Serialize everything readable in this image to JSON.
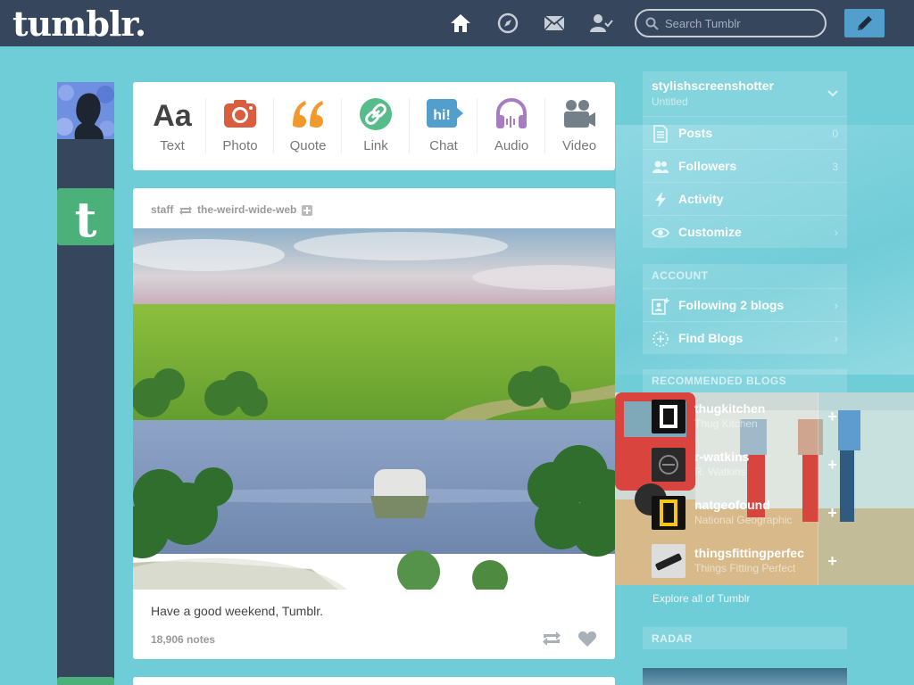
{
  "header": {
    "logo": "tumblr.",
    "search_placeholder": "Search Tumblr",
    "nav": [
      "home-icon",
      "explore-icon",
      "inbox-icon",
      "account-icon"
    ]
  },
  "composer": {
    "types": [
      {
        "label": "Text",
        "icon": "text-icon",
        "color": "#444444"
      },
      {
        "label": "Photo",
        "icon": "camera-icon",
        "color": "#d95e40"
      },
      {
        "label": "Quote",
        "icon": "quote-icon",
        "color": "#f2992e"
      },
      {
        "label": "Link",
        "icon": "link-icon",
        "color": "#56bc8a"
      },
      {
        "label": "Chat",
        "icon": "chat-icon",
        "color": "#529ecc"
      },
      {
        "label": "Audio",
        "icon": "headphones-icon",
        "color": "#a77dc2"
      },
      {
        "label": "Video",
        "icon": "video-camera-icon",
        "color": "#748089"
      }
    ]
  },
  "post": {
    "author": "staff",
    "reblogged_from": "the-weird-wide-web",
    "caption": "Have a good weekend, Tumblr.",
    "notes": "18,906 notes"
  },
  "sidebar": {
    "blog_name": "stylishscreenshotter",
    "blog_title": "Untitled",
    "blog_items": [
      {
        "label": "Posts",
        "count": "0",
        "icon": "posts-icon"
      },
      {
        "label": "Followers",
        "count": "3",
        "icon": "followers-icon"
      },
      {
        "label": "Activity",
        "count": "",
        "icon": "activity-icon"
      },
      {
        "label": "Customize",
        "count": "",
        "icon": "eye-icon"
      }
    ],
    "account_title": "ACCOUNT",
    "account_items": [
      {
        "label": "Following 2 blogs",
        "icon": "following-icon"
      },
      {
        "label": "Find Blogs",
        "icon": "find-blogs-icon"
      }
    ],
    "recommended_title": "RECOMMENDED BLOGS",
    "recommended": [
      {
        "name": "thugkitchen",
        "sub": "Thug Kitchen"
      },
      {
        "name": "r-watkins",
        "sub": "R. Watkins"
      },
      {
        "name": "natgeofound",
        "sub": "National Geographic"
      },
      {
        "name": "thingsfittingperfec",
        "sub": "Things Fitting Perfect"
      }
    ],
    "explore": "Explore all of Tumblr",
    "radar_title": "RADAR"
  },
  "colors": {
    "background": "#6fcdd8",
    "header": "#36465d",
    "compose": "#529ecc"
  }
}
